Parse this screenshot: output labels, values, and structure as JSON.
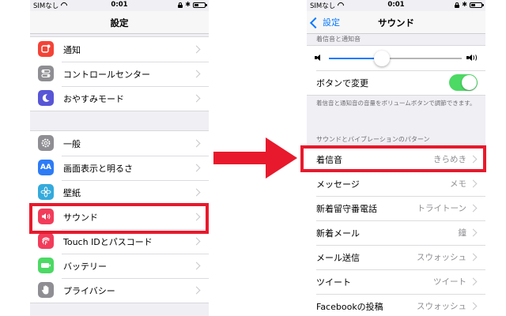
{
  "status_bar": {
    "carrier": "SIMなし",
    "time": "0:01"
  },
  "left": {
    "title": "設定",
    "group1": [
      {
        "label": "通知",
        "icon": "notifications-icon",
        "color": "#f44336"
      },
      {
        "label": "コントロールセンター",
        "icon": "control-center-icon",
        "color": "#8e8e93"
      },
      {
        "label": "おやすみモード",
        "icon": "moon-icon",
        "color": "#5856d6"
      }
    ],
    "group2": [
      {
        "label": "一般",
        "icon": "gear-icon",
        "color": "#8e8e93"
      },
      {
        "label": "画面表示と明るさ",
        "icon": "display-brightness-icon",
        "color": "#2d7cf6",
        "glyph": "AA"
      },
      {
        "label": "壁紙",
        "icon": "wallpaper-icon",
        "color": "#34aadc"
      },
      {
        "label": "サウンド",
        "icon": "speaker-icon",
        "color": "#f23c5a"
      },
      {
        "label": "Touch IDとパスコード",
        "icon": "fingerprint-icon",
        "color": "#f23c5a"
      },
      {
        "label": "バッテリー",
        "icon": "battery-icon",
        "color": "#4cd964"
      },
      {
        "label": "プライバシー",
        "icon": "hand-icon",
        "color": "#8e8e93"
      }
    ]
  },
  "right": {
    "back_label": "設定",
    "title": "サウンド",
    "section1_header": "着信音と通知音",
    "volume_level": 0.4,
    "toggle_label": "ボタンで変更",
    "toggle_on": true,
    "footnote": "着信音と通知音の音量をボリュームボタンで調節できます。",
    "section2_header": "サウンドとバイブレーションのパターン",
    "rows": [
      {
        "label": "着信音",
        "value": "きらめき"
      },
      {
        "label": "メッセージ",
        "value": "メモ"
      },
      {
        "label": "新着留守番電話",
        "value": "トライトーン"
      },
      {
        "label": "新着メール",
        "value": "鐘"
      },
      {
        "label": "メール送信",
        "value": "スウォッシュ"
      },
      {
        "label": "ツイート",
        "value": "ツイート"
      },
      {
        "label": "Facebookの投稿",
        "value": "スウォッシュ"
      }
    ]
  },
  "colors": {
    "highlight": "#e8192c",
    "accent": "#0a7aff",
    "toggle": "#4cd964"
  }
}
